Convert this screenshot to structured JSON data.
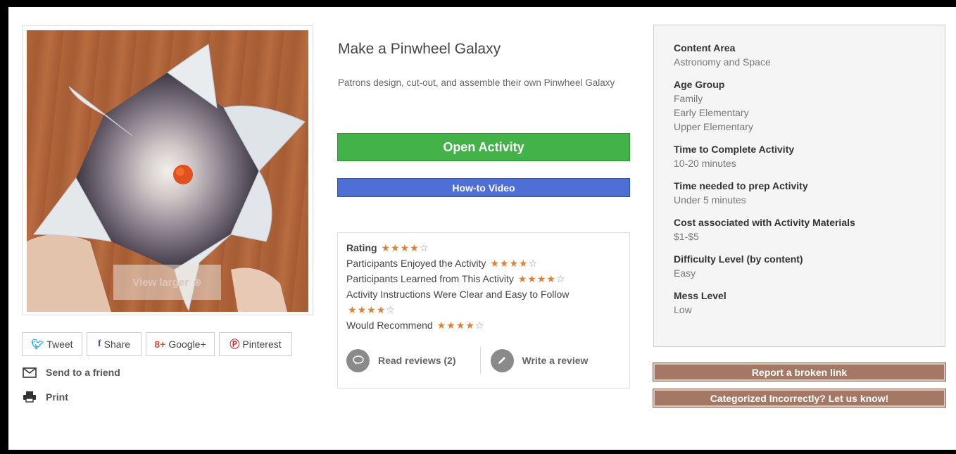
{
  "activity": {
    "title": "Make a Pinwheel Galaxy",
    "description": "Patrons design, cut-out, and assemble their own Pinwheel Galaxy",
    "view_larger": "View larger"
  },
  "buttons": {
    "open_activity": "Open Activity",
    "howto_video": "How-to Video",
    "report_broken": "Report a broken link",
    "categorized_incorrectly": "Categorized Incorrectly? Let us know!"
  },
  "share": {
    "tweet": "Tweet",
    "share": "Share",
    "google_plus": "Google+",
    "pinterest": "Pinterest",
    "send_to_friend": "Send to a friend",
    "print": "Print"
  },
  "rating": {
    "label": "Rating",
    "overall_stars": 4,
    "max_stars": 5,
    "criteria": [
      {
        "label": "Participants Enjoyed the Activity",
        "stars": 4
      },
      {
        "label": "Participants Learned from This Activity",
        "stars": 4
      },
      {
        "label": "Activity Instructions Were Clear and Easy to Follow",
        "stars": 4
      },
      {
        "label": "Would Recommend",
        "stars": 4
      }
    ],
    "read_reviews": "Read reviews (2)",
    "write_review": "Write a review"
  },
  "info": [
    {
      "label": "Content Area",
      "values": [
        "Astronomy and Space"
      ]
    },
    {
      "label": "Age Group",
      "values": [
        "Family",
        "Early Elementary",
        "Upper Elementary"
      ]
    },
    {
      "label": "Time to Complete Activity",
      "values": [
        "10-20 minutes"
      ]
    },
    {
      "label": "Time needed to prep Activity",
      "values": [
        "Under 5 minutes"
      ]
    },
    {
      "label": "Cost associated with Activity Materials",
      "values": [
        "$1-$5"
      ]
    },
    {
      "label": "Difficulty Level (by content)",
      "values": [
        "Easy"
      ]
    },
    {
      "label": "Mess Level",
      "values": [
        "Low"
      ]
    }
  ],
  "colors": {
    "open_green": "#42b249",
    "video_blue": "#4e6fd6",
    "star_orange": "#e57f2d",
    "brown_button": "#a47864"
  },
  "icons": {
    "zoom": "magnifier-plus-icon",
    "twitter": "twitter-bird-icon",
    "facebook": "facebook-f-icon",
    "google": "google-plus-icon",
    "pinterest": "pinterest-icon",
    "mail": "envelope-icon",
    "print": "printer-icon",
    "read": "speech-bubble-icon",
    "write": "pencil-icon"
  }
}
